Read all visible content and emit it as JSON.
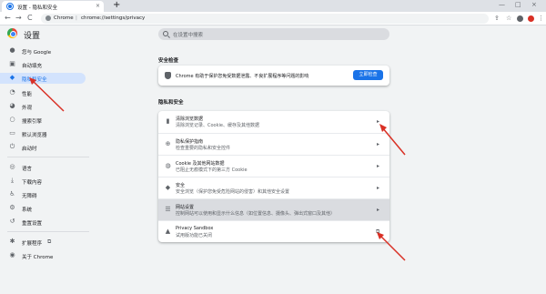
{
  "tab": {
    "title": "设置 - 隐私和安全",
    "close": "×",
    "new": "+"
  },
  "window_controls": {
    "minimize": "—",
    "maximize": "□",
    "close": "×"
  },
  "toolbar": {
    "back": "←",
    "forward": "→",
    "reload": "C",
    "chrome_label": "Chrome",
    "separator": "|",
    "url": "chrome://settings/privacy"
  },
  "page": {
    "title": "设置"
  },
  "search": {
    "placeholder": "在设置中搜索"
  },
  "sidebar": {
    "items": [
      {
        "label": "您与 Google",
        "icon": "person-icon",
        "glyph": "●"
      },
      {
        "label": "自动填充",
        "icon": "clipboard-icon",
        "glyph": "▣"
      },
      {
        "label": "隐私和安全",
        "icon": "shield-icon",
        "glyph": "◆"
      },
      {
        "label": "性能",
        "icon": "speed-icon",
        "glyph": "◔"
      },
      {
        "label": "外观",
        "icon": "palette-icon",
        "glyph": "◕"
      },
      {
        "label": "搜索引擎",
        "icon": "search-icon",
        "glyph": "○"
      },
      {
        "label": "默认浏览器",
        "icon": "browser-icon",
        "glyph": "▭"
      },
      {
        "label": "启动时",
        "icon": "power-icon",
        "glyph": "⏻"
      },
      {
        "label": "语言",
        "icon": "globe-icon",
        "glyph": "◎"
      },
      {
        "label": "下载内容",
        "icon": "download-icon",
        "glyph": "⤓"
      },
      {
        "label": "无障碍",
        "icon": "accessibility-icon",
        "glyph": "♿"
      },
      {
        "label": "系统",
        "icon": "wrench-icon",
        "glyph": "⚙"
      },
      {
        "label": "重置设置",
        "icon": "reset-icon",
        "glyph": "↺"
      },
      {
        "label": "扩展程序",
        "icon": "puzzle-icon",
        "glyph": "✱",
        "external": "⧉"
      },
      {
        "label": "关于 Chrome",
        "icon": "chrome-icon",
        "glyph": "◉"
      }
    ]
  },
  "safety": {
    "section_title": "安全检查",
    "text": "Chrome 有助于保护您免受数据泄露、不良扩展程序等问题的影响",
    "button": "立即检查"
  },
  "privacy": {
    "section_title": "隐私和安全",
    "rows": [
      {
        "title": "清除浏览数据",
        "sub": "清除浏览记录、Cookie、缓存及其他数据",
        "icon": "trash-icon",
        "glyph": "▮",
        "action": "▸"
      },
      {
        "title": "隐私保护指南",
        "sub": "检查重要的隐私和安全控件",
        "icon": "privacy-guide-icon",
        "glyph": "⊕",
        "action": "▸"
      },
      {
        "title": "Cookie 及其他网站数据",
        "sub": "已阻止无痕模式下的第三方 Cookie",
        "icon": "cookie-icon",
        "glyph": "◍",
        "action": "▸"
      },
      {
        "title": "安全",
        "sub": "安全浏览（保护您免受危险网站的侵害）和其他安全设置",
        "icon": "security-shield-icon",
        "glyph": "◆",
        "action": "▸"
      },
      {
        "title": "网站设置",
        "sub": "控制网站可以使用和显示什么信息（如位置信息、摄像头、弹出式窗口及其他）",
        "icon": "site-settings-icon",
        "glyph": "☰",
        "action": "▸"
      },
      {
        "title": "Privacy Sandbox",
        "sub": "试用版功能已关闭",
        "icon": "sandbox-icon",
        "glyph": "▲",
        "action": "⧉"
      }
    ]
  },
  "colors": {
    "accent": "#1a73e8",
    "annotation": "#d93025",
    "active_nav": "#d3e3fd"
  }
}
